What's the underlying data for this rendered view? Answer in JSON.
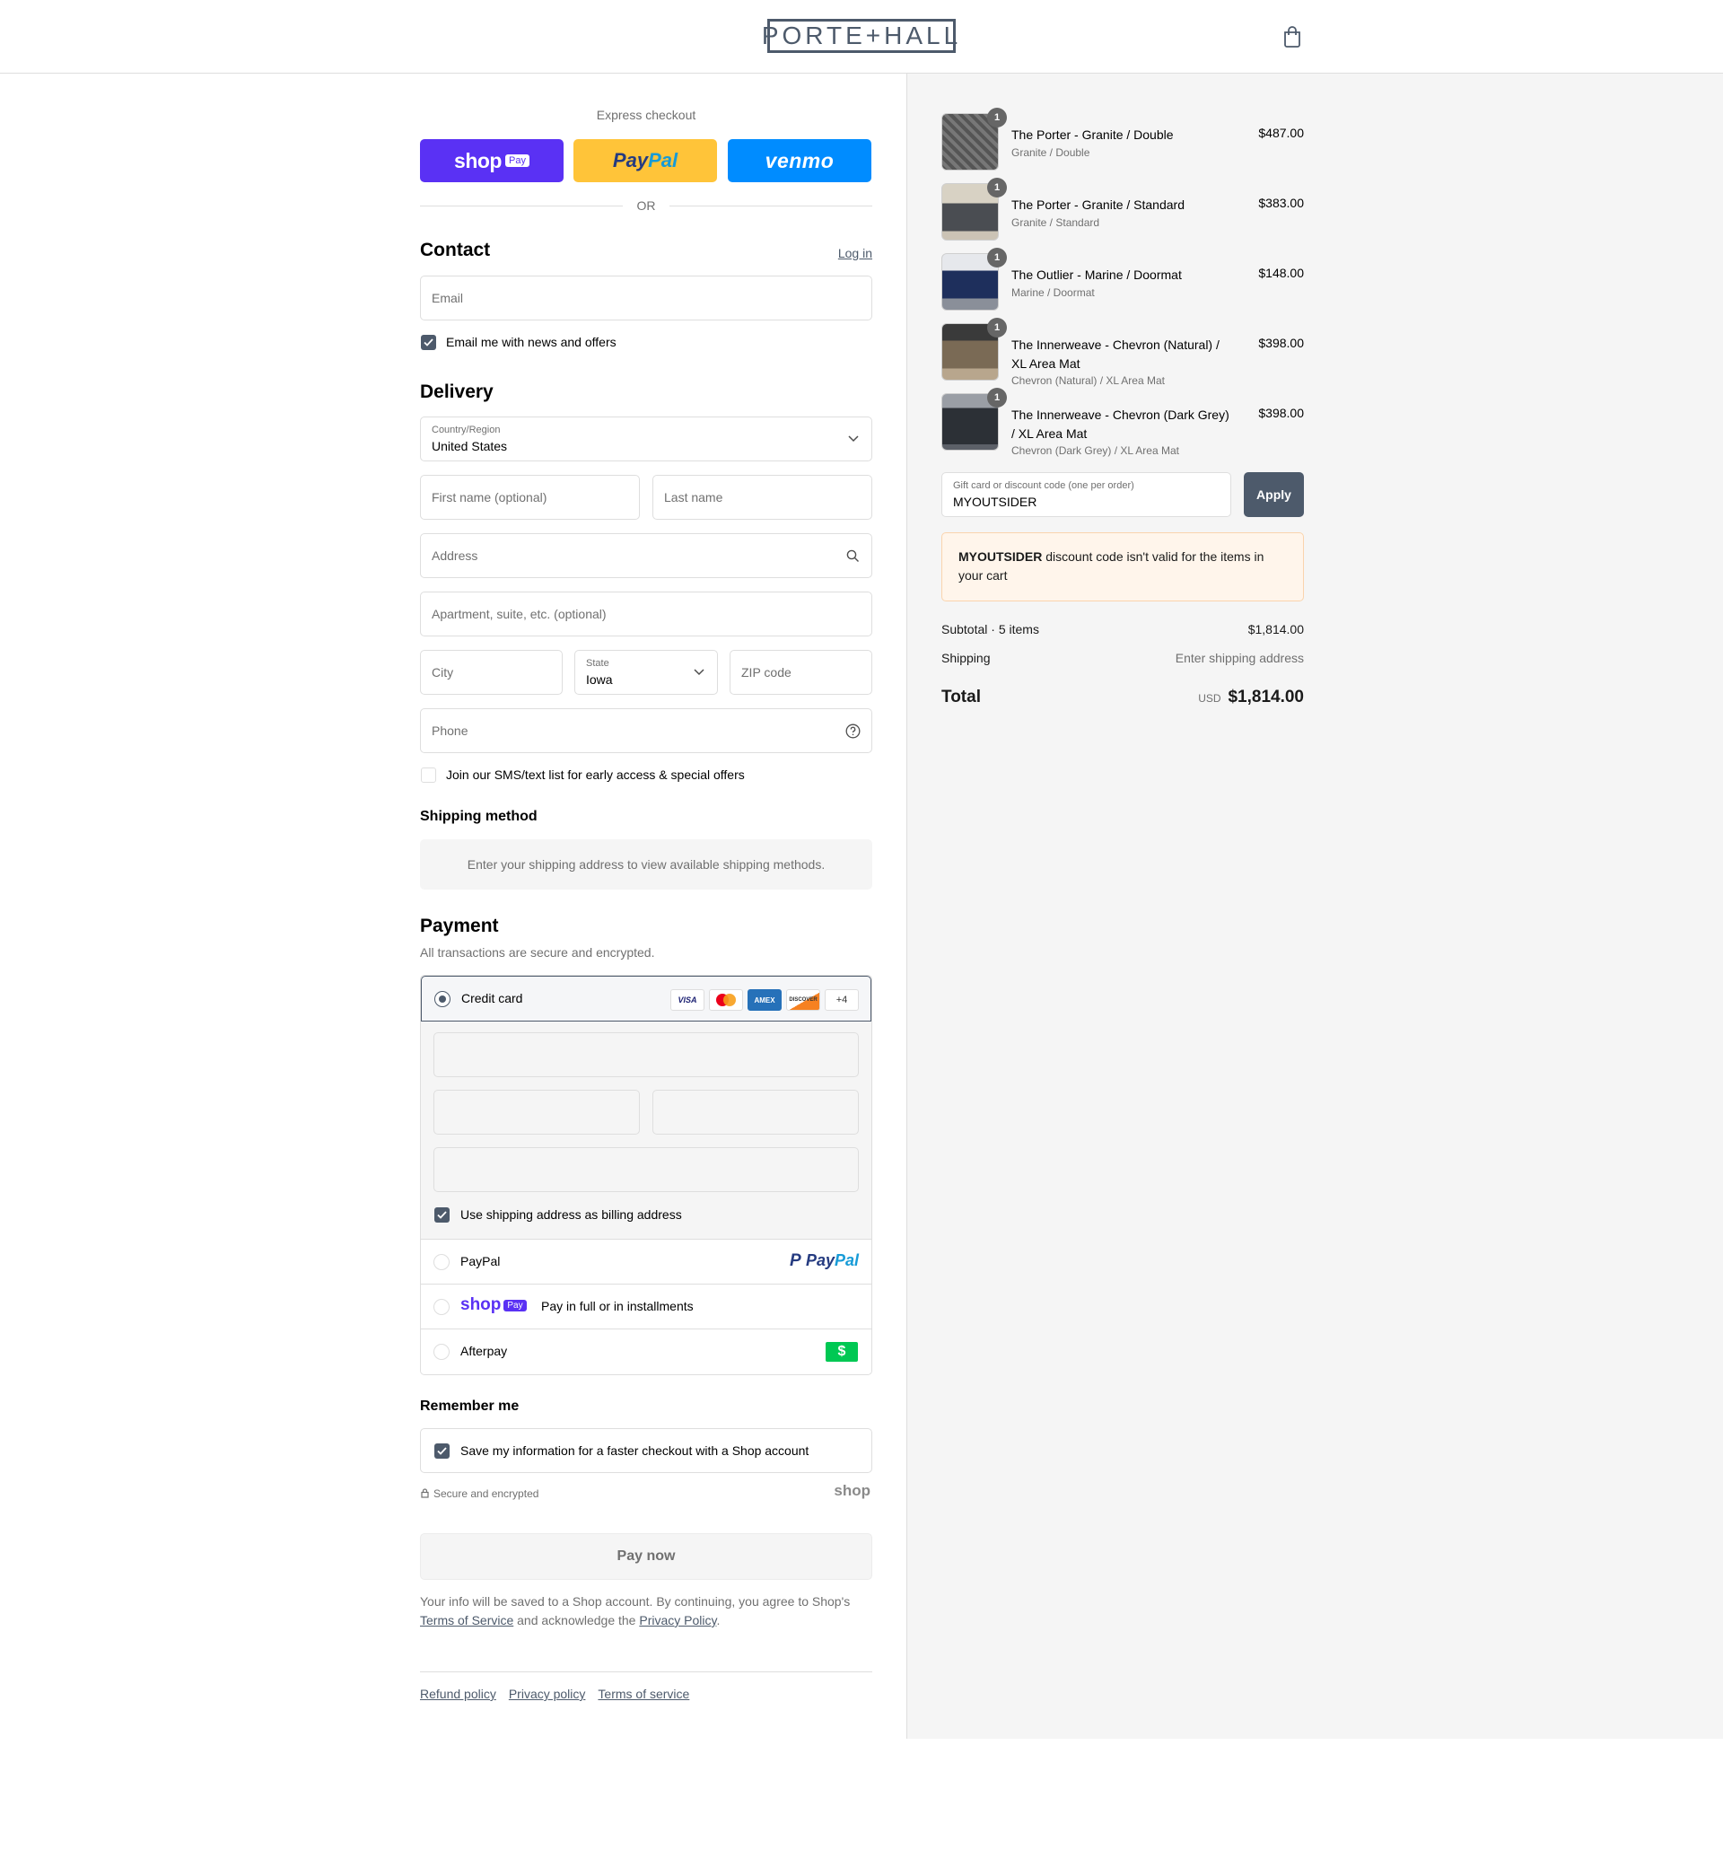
{
  "brand": {
    "logo_text": "PORTE+HALL"
  },
  "express": {
    "title": "Express checkout",
    "shop_word": "shop",
    "shop_pill": "Pay",
    "paypal_a": "Pay",
    "paypal_b": "Pal",
    "venmo": "venmo",
    "or": "OR"
  },
  "contact": {
    "title": "Contact",
    "login": "Log in",
    "email_placeholder": "Email",
    "news_label": "Email me with news and offers"
  },
  "delivery": {
    "title": "Delivery",
    "country_label": "Country/Region",
    "country_value": "United States",
    "first_name_placeholder": "First name (optional)",
    "last_name_placeholder": "Last name",
    "address_placeholder": "Address",
    "apartment_placeholder": "Apartment, suite, etc. (optional)",
    "city_placeholder": "City",
    "state_label": "State",
    "state_value": "Iowa",
    "zip_placeholder": "ZIP code",
    "phone_placeholder": "Phone",
    "sms_label": "Join our SMS/text list for early access & special offers"
  },
  "shipping_method": {
    "title": "Shipping method",
    "info": "Enter your shipping address to view available shipping methods."
  },
  "payment": {
    "title": "Payment",
    "subtitle": "All transactions are secure and encrypted.",
    "credit_card_label": "Credit card",
    "cards": [
      "VISA",
      "AMEX",
      "DISCOVER",
      "+4"
    ],
    "billing_label": "Use shipping address as billing address",
    "paypal_label": "PayPal",
    "paypal_logo_a": "Pay",
    "paypal_logo_b": "Pal",
    "shoppay_word": "shop",
    "shoppay_pill": "Pay",
    "shoppay_text": "Pay in full or in installments",
    "afterpay_label": "Afterpay",
    "afterpay_symbol": "$"
  },
  "remember": {
    "title": "Remember me",
    "save_label": "Save my information for a faster checkout with a Shop account",
    "secure_text": "Secure and encrypted",
    "shop_brand": "shop"
  },
  "pay_now": "Pay now",
  "legal": {
    "line1": "Your info will be saved to a Shop account. By continuing, you agree to Shop's",
    "terms_link": "Terms of Service",
    "middle": "and acknowledge the",
    "privacy_link": "Privacy Policy",
    "end": "."
  },
  "footer_links": [
    "Refund policy",
    "Privacy policy",
    "Terms of service"
  ],
  "cart": {
    "items": [
      {
        "name": "The Porter - Granite / Double",
        "variant": "Granite / Double",
        "price": "$487.00",
        "qty": "1"
      },
      {
        "name": "The Porter - Granite / Standard",
        "variant": "Granite / Standard",
        "price": "$383.00",
        "qty": "1"
      },
      {
        "name": "The Outlier - Marine / Doormat",
        "variant": "Marine / Doormat",
        "price": "$148.00",
        "qty": "1"
      },
      {
        "name": "The Innerweave - Chevron (Natural) / XL Area Mat",
        "variant": "Chevron (Natural) / XL Area Mat",
        "price": "$398.00",
        "qty": "1"
      },
      {
        "name": "The Innerweave - Chevron (Dark Grey) / XL Area Mat",
        "variant": "Chevron (Dark Grey) / XL Area Mat",
        "price": "$398.00",
        "qty": "1"
      }
    ],
    "discount_label": "Gift card or discount code (one per order)",
    "discount_value": "MYOUTSIDER",
    "apply": "Apply",
    "error_code": "MYOUTSIDER",
    "error_text": "discount code isn't valid for the items in your cart",
    "subtotal_label": "Subtotal · 5 items",
    "subtotal_value": "$1,814.00",
    "shipping_label": "Shipping",
    "shipping_value": "Enter shipping address",
    "total_label": "Total",
    "currency": "USD",
    "total_value": "$1,814.00"
  },
  "colors": {
    "accent": "#4d5a6b",
    "shop_purple": "#5a31f4",
    "paypal_yellow": "#ffc439",
    "venmo_blue": "#008cff",
    "afterpay_green": "#00c853"
  }
}
